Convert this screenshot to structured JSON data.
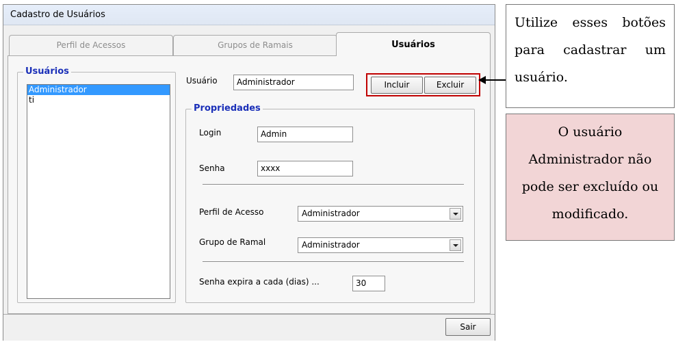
{
  "window": {
    "title": "Cadastro de Usuários"
  },
  "tabs": [
    {
      "label": "Perfil de Acessos"
    },
    {
      "label": "Grupos de Ramais"
    },
    {
      "label": "Usuários"
    }
  ],
  "users_group": {
    "legend": "Usuários",
    "items": [
      "Administrador",
      "ti"
    ],
    "selected": "Administrador"
  },
  "user_field": {
    "label": "Usuário",
    "value": "Administrador"
  },
  "buttons": {
    "incluir": "Incluir",
    "excluir": "Excluir",
    "sair": "Sair"
  },
  "properties": {
    "legend": "Propriedades",
    "login_label": "Login",
    "login_value": "Admin",
    "senha_label": "Senha",
    "senha_value": "xxxx",
    "perfil_label": "Perfil de Acesso",
    "perfil_value": "Administrador",
    "grupo_label": "Grupo de Ramal",
    "grupo_value": "Administrador",
    "expira_label": "Senha expira a cada (dias) ...",
    "expira_value": "30"
  },
  "annotations": {
    "note1": "Utilize esses botões para cadastrar um usuário.",
    "note2": "O usuário Administrador não pode ser excluído ou modificado."
  },
  "colors": {
    "highlight_border": "#c00000",
    "note2_background": "#f2d5d6",
    "legend_text": "#1a2fb8",
    "selection": "#3399ff"
  }
}
